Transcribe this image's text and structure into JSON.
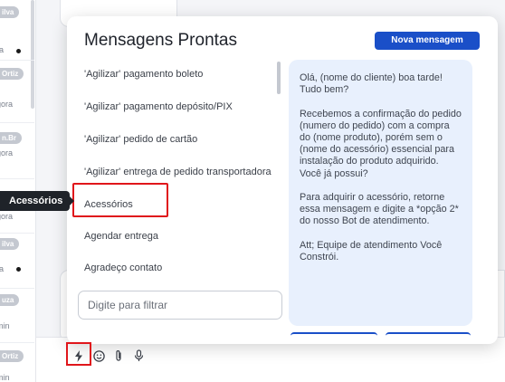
{
  "sidebar": {
    "conversations": [
      {
        "tag": "ilva",
        "time": "",
        "unread": false
      },
      {
        "tag": "",
        "time": "ra",
        "unread": true
      },
      {
        "tag": "Ortiz",
        "time": "gora",
        "unread": false
      },
      {
        "tag": "n.Br",
        "time": "gora",
        "unread": false
      },
      {
        "tag": "",
        "time": "gora",
        "unread": false
      },
      {
        "tag": "ilva",
        "time": "ra",
        "unread": true
      },
      {
        "tag": "uza",
        "time": "min",
        "unread": false
      },
      {
        "tag": "Ortiz",
        "time": "min",
        "unread": false
      }
    ]
  },
  "tooltip": {
    "text": "Acessórios"
  },
  "modal": {
    "title": "Mensagens Prontas",
    "new_button": "Nova mensagem",
    "items": [
      "'Agilizar' pagamento boleto",
      "'Agilizar' pagamento depósito/PIX",
      "'Agilizar' pedido de cartão",
      "'Agilizar' entrega de pedido transportadora",
      "Acessórios",
      "Agendar entrega",
      "Agradeço contato"
    ],
    "filter_placeholder": "Digite para filtrar",
    "preview_text": "Olá, (nome do cliente) boa tarde!\nTudo bem?\n\nRecebemos a confirmação do pedido (numero do pedido) com a compra do (nome produto), porém sem o (nome do acessório) essencial para instalação do produto adquirido.\nVocê já possui?\n\nPara adquirir o acessório, retorne essa mensagem e digite a *opção 2* do nosso Bot de atendimento.\n\nAtt; Equipe de atendimento Você Constrói."
  },
  "toolbar": {
    "icons": [
      "bolt-icon",
      "emoji-icon",
      "attach-icon",
      "mic-icon"
    ]
  },
  "colors": {
    "accent": "#1a4fc8",
    "highlight": "#e0161b",
    "preview_bg": "#e8f0fd"
  }
}
